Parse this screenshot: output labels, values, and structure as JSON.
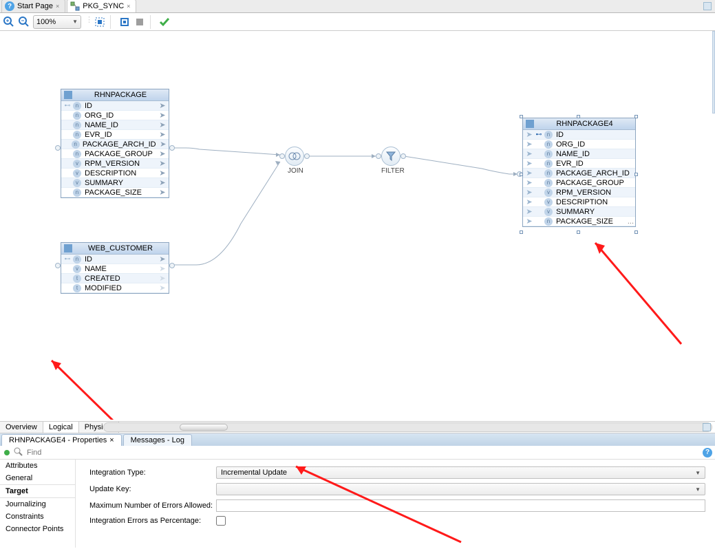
{
  "tabs": {
    "start": "Start Page",
    "active": "PKG_SYNC"
  },
  "toolbar": {
    "zoom": "100%"
  },
  "entities": {
    "rhnpackage": {
      "title": "RHNPACKAGE",
      "cols": [
        "ID",
        "ORG_ID",
        "NAME_ID",
        "EVR_ID",
        "PACKAGE_ARCH_ID",
        "PACKAGE_GROUP",
        "RPM_VERSION",
        "DESCRIPTION",
        "SUMMARY",
        "PACKAGE_SIZE"
      ]
    },
    "web_customer": {
      "title": "WEB_CUSTOMER",
      "cols": [
        "ID",
        "NAME",
        "CREATED",
        "MODIFIED"
      ]
    },
    "rhnpackage4": {
      "title": "RHNPACKAGE4",
      "cols": [
        "ID",
        "ORG_ID",
        "NAME_ID",
        "EVR_ID",
        "PACKAGE_ARCH_ID",
        "PACKAGE_GROUP",
        "RPM_VERSION",
        "DESCRIPTION",
        "SUMMARY",
        "PACKAGE_SIZE"
      ]
    }
  },
  "nodes": {
    "join": "JOIN",
    "filter": "FILTER"
  },
  "viewTabs": {
    "overview": "Overview",
    "logical": "Logical",
    "physical": "Physical"
  },
  "panelTabs": {
    "props": "RHNPACKAGE4 - Properties",
    "log": "Messages - Log"
  },
  "find": "Find",
  "nav": {
    "attributes": "Attributes",
    "general": "General",
    "target": "Target",
    "journalizing": "Journalizing",
    "constraints": "Constraints",
    "connector": "Connector Points"
  },
  "props": {
    "integrationTypeLbl": "Integration Type:",
    "integrationTypeVal": "Incremental Update",
    "updateKeyLbl": "Update Key:",
    "updateKeyVal": "",
    "maxErrorsLbl": "Maximum Number of Errors Allowed:",
    "pctLbl": "Integration Errors as Percentage:"
  },
  "ellipsis": "..."
}
